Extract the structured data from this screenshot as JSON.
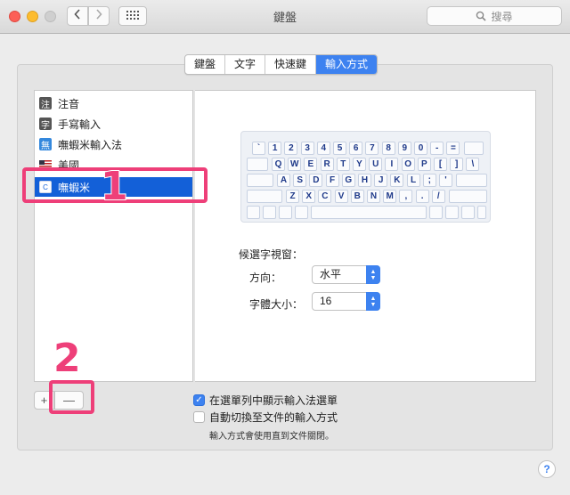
{
  "window": {
    "title": "鍵盤"
  },
  "toolbar": {
    "search_placeholder": "搜尋"
  },
  "tabs": [
    {
      "label": "鍵盤",
      "active": false
    },
    {
      "label": "文字",
      "active": false
    },
    {
      "label": "快速鍵",
      "active": false
    },
    {
      "label": "輸入方式",
      "active": true
    }
  ],
  "sources": [
    {
      "label": "注音",
      "icon": "注"
    },
    {
      "label": "手寫輸入",
      "icon": "字"
    },
    {
      "label": "嘸蝦米輸入法",
      "icon": "無"
    },
    {
      "label": "美國",
      "icon": "us-flag-icon"
    },
    {
      "label": "嘸蝦米",
      "icon": "C",
      "selected": true
    }
  ],
  "annotations": {
    "one": "1",
    "two": "2"
  },
  "keyboard": {
    "row1": [
      "`",
      "1",
      "2",
      "3",
      "4",
      "5",
      "6",
      "7",
      "8",
      "9",
      "0",
      "-",
      "="
    ],
    "row2": [
      "Q",
      "W",
      "E",
      "R",
      "T",
      "Y",
      "U",
      "I",
      "O",
      "P",
      "[",
      "]",
      "\\"
    ],
    "row3": [
      "A",
      "S",
      "D",
      "F",
      "G",
      "H",
      "J",
      "K",
      "L",
      ";",
      "'"
    ],
    "row4": [
      "Z",
      "X",
      "C",
      "V",
      "B",
      "N",
      "M",
      ",",
      ".",
      "/"
    ]
  },
  "candidate": {
    "heading": "候選字視窗：",
    "direction_label": "方向：",
    "direction_value": "水平",
    "font_size_label": "字體大小：",
    "font_size_value": "16"
  },
  "buttons": {
    "add": "+",
    "remove": "—",
    "help": "?"
  },
  "options": {
    "show_in_menu": {
      "label": "在選單列中顯示輸入法選單",
      "checked": true
    },
    "auto_switch": {
      "label": "自動切換至文件的輸入方式",
      "checked": false
    },
    "note": "輸入方式會使用直到文件關閉。"
  },
  "colors": {
    "accent": "#3d82f0",
    "selection": "#1360d8",
    "annotation": "#ee3f79"
  }
}
